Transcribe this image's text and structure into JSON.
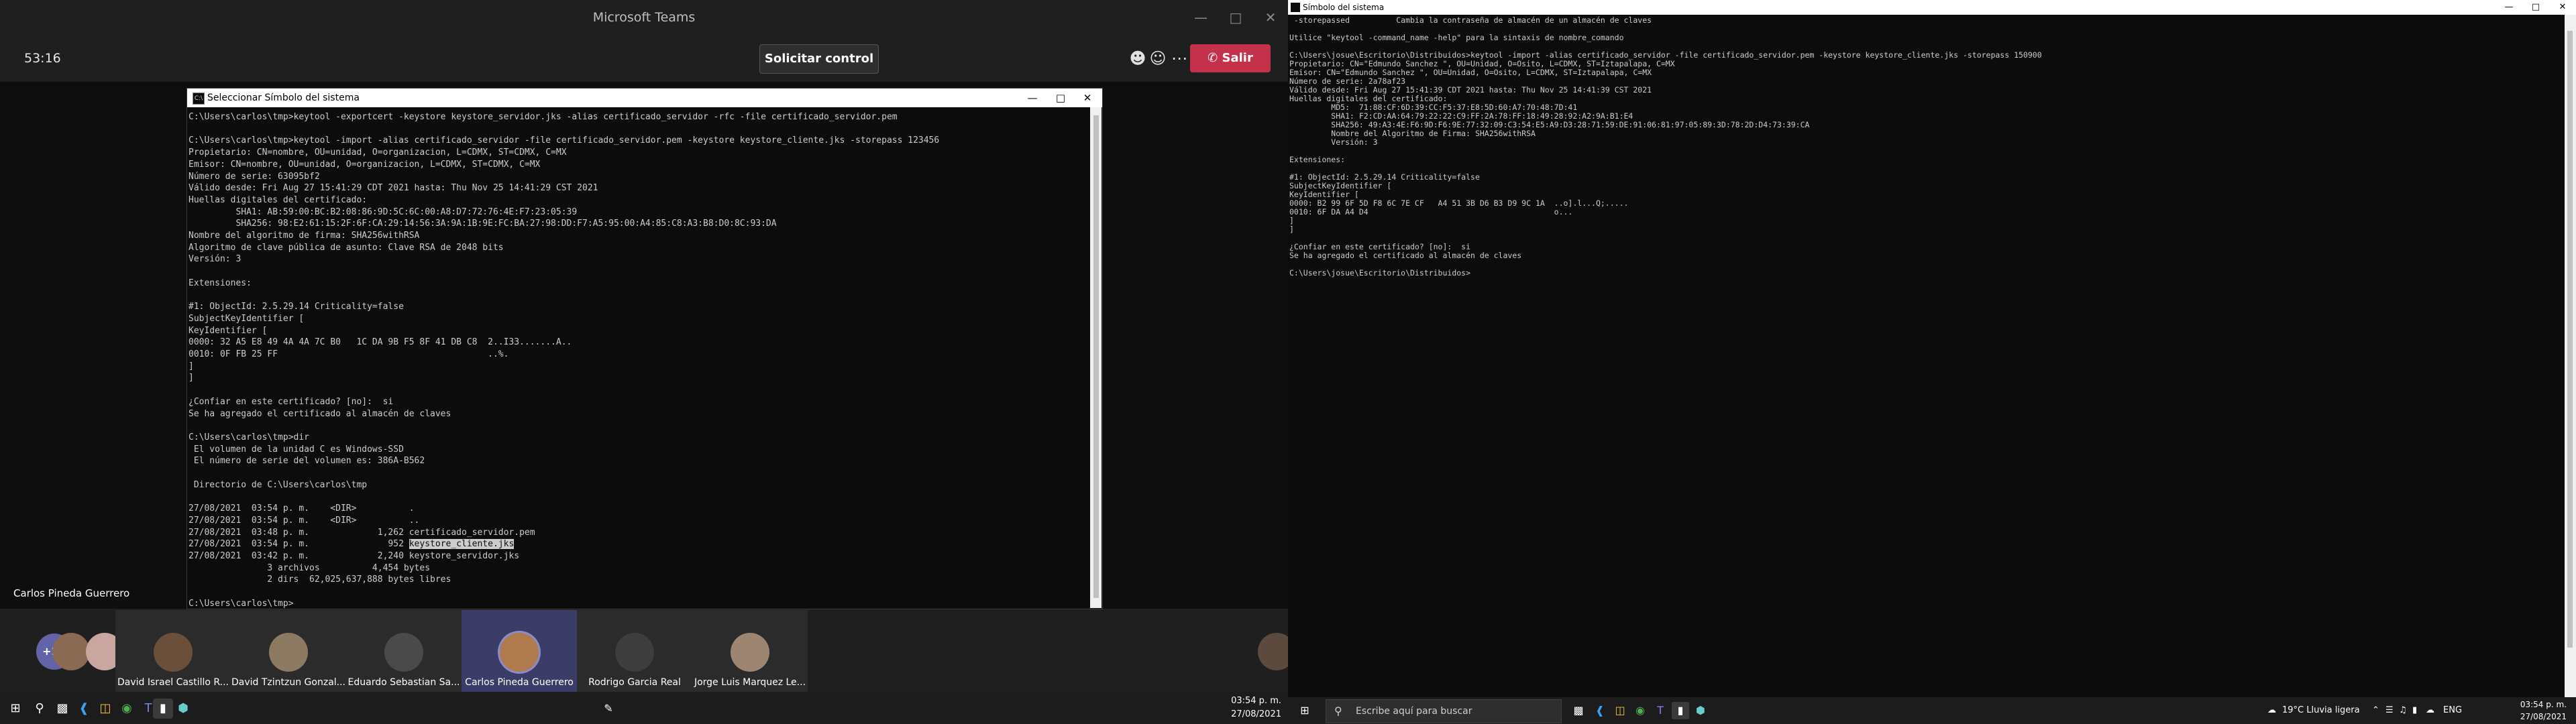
{
  "teams": {
    "window_title": "Microsoft Teams",
    "timer": "53:16",
    "request_control_label": "Solicitar control",
    "leave_label": "Salir",
    "presenter_name": "Carlos Pineda Guerrero",
    "more_participants": "+27",
    "participants": [
      {
        "name": "David Israel Castillo R...",
        "color": "#6b4f3a"
      },
      {
        "name": "David Tzintzun Gonzal...",
        "color": "#8d7a63"
      },
      {
        "name": "Eduardo Sebastian Sa...",
        "color": "#4a4a4a"
      },
      {
        "name": "Carlos Pineda Guerrero",
        "color": "#b07a4f"
      },
      {
        "name": "Rodrigo Garcia Real",
        "color": "#3d3d3d"
      },
      {
        "name": "Jorge Luis Marquez Le...",
        "color": "#9c8571"
      }
    ]
  },
  "cmd1": {
    "title": "Seleccionar Símbolo del sistema",
    "lines": [
      "C:\\Users\\carlos\\tmp>keytool -exportcert -keystore keystore_servidor.jks -alias certificado_servidor -rfc -file certificado_servidor.pem",
      "",
      "C:\\Users\\carlos\\tmp>keytool -import -alias certificado_servidor -file certificado_servidor.pem -keystore keystore_cliente.jks -storepass 123456",
      "Propietario: CN=nombre, OU=unidad, O=organizacion, L=CDMX, ST=CDMX, C=MX",
      "Emisor: CN=nombre, OU=unidad, O=organizacion, L=CDMX, ST=CDMX, C=MX",
      "Número de serie: 63095bf2",
      "Válido desde: Fri Aug 27 15:41:29 CDT 2021 hasta: Thu Nov 25 14:41:29 CST 2021",
      "Huellas digitales del certificado:",
      "         SHA1: AB:59:00:BC:B2:08:86:9D:5C:6C:00:A8:D7:72:76:4E:F7:23:05:39",
      "         SHA256: 98:E2:61:15:2F:6F:CA:29:14:56:3A:9A:1B:9E:FC:BA:27:98:DD:F7:A5:95:00:A4:85:C8:A3:B8:D0:8C:93:DA",
      "Nombre del algoritmo de firma: SHA256withRSA",
      "Algoritmo de clave pública de asunto: Clave RSA de 2048 bits",
      "Versión: 3",
      "",
      "Extensiones:",
      "",
      "#1: ObjectId: 2.5.29.14 Criticality=false",
      "SubjectKeyIdentifier [",
      "KeyIdentifier [",
      "0000: 32 A5 E8 49 4A 4A 7C B0   1C DA 9B F5 8F 41 DB C8  2..I33.......A..",
      "0010: 0F FB 25 FF                                        ..%.",
      "]",
      "]",
      "",
      "¿Confiar en este certificado? [no]:  si",
      "Se ha agregado el certificado al almacén de claves",
      "",
      "C:\\Users\\carlos\\tmp>dir",
      " El volumen de la unidad C es Windows-SSD",
      " El número de serie del volumen es: 386A-B562",
      "",
      " Directorio de C:\\Users\\carlos\\tmp",
      "",
      "27/08/2021  03:54 p. m.    <DIR>          .",
      "27/08/2021  03:54 p. m.    <DIR>          ..",
      "27/08/2021  03:48 p. m.             1,262 certificado_servidor.pem",
      "27/08/2021  03:54 p. m.               952 ",
      "27/08/2021  03:42 p. m.             2,240 keystore_servidor.jks",
      "               3 archivos          4,454 bytes",
      "               2 dirs  62,025,637,888 bytes libres",
      "",
      "C:\\Users\\carlos\\tmp>"
    ],
    "selected_text": "keystore_cliente.jks"
  },
  "cmd2": {
    "title": "Símbolo del sistema",
    "lines": [
      " -storepassed          Cambia la contraseña de almacén de un almacén de claves",
      "",
      "Utilice \"keytool -command_name -help\" para la sintaxis de nombre_comando",
      "",
      "C:\\Users\\josue\\Escritorio\\Distribuidos>keytool -import -alias certificado_servidor -file certificado_servidor.pem -keystore keystore_cliente.jks -storepass 150900",
      "Propietario: CN=\"Edmundo Sanchez \", OU=Unidad, O=Osito, L=CDMX, ST=Iztapalapa, C=MX",
      "Emisor: CN=\"Edmundo Sanchez \", OU=Unidad, O=Osito, L=CDMX, ST=Iztapalapa, C=MX",
      "Número de serie: 2a78af23",
      "Válido desde: Fri Aug 27 15:41:39 CDT 2021 hasta: Thu Nov 25 14:41:39 CST 2021",
      "Huellas digitales del certificado:",
      "         MD5:  71:88:CF:6D:39:CC:F5:37:E8:5D:60:A7:70:48:7D:41",
      "         SHA1: F2:CD:AA:64:79:22:22:C9:FF:2A:78:FF:18:49:28:92:A2:9A:B1:E4",
      "         SHA256: 49:A3:4E:F6:9D:F6:9E:77:32:09:C3:54:E5:A9:D3:28:71:59:DE:91:06:81:97:05:89:3D:78:2D:D4:73:39:CA",
      "         Nombre del Algoritmo de Firma: SHA256withRSA",
      "         Versión: 3",
      "",
      "Extensiones:",
      "",
      "#1: ObjectId: 2.5.29.14 Criticality=false",
      "SubjectKeyIdentifier [",
      "KeyIdentifier [",
      "0000: B2 99 6F 5D F8 6C 7E CF   A4 51 3B D6 B3 D9 9C 1A  ..o].l...Q;.....",
      "0010: 6F DA A4 D4                                        o...",
      "]",
      "]",
      "",
      "¿Confiar en este certificado? [no]:  si",
      "Se ha agregado el certificado al almacén de claves",
      "",
      "C:\\Users\\josue\\Escritorio\\Distribuidos>"
    ]
  },
  "taskbar1": {
    "time": "03:54 p. m.",
    "date": "27/08/2021"
  },
  "taskbar2": {
    "search_placeholder": "Escribe aquí para buscar",
    "weather": "19°C  Lluvia ligera",
    "language": "ENG",
    "time": "03:54 p. m.",
    "date": "27/08/2021"
  },
  "colors": {
    "leave": "#c4314b",
    "teams_purple": "#6264a7",
    "console_bg": "#0c0c0c",
    "console_fg": "#cccccc"
  }
}
